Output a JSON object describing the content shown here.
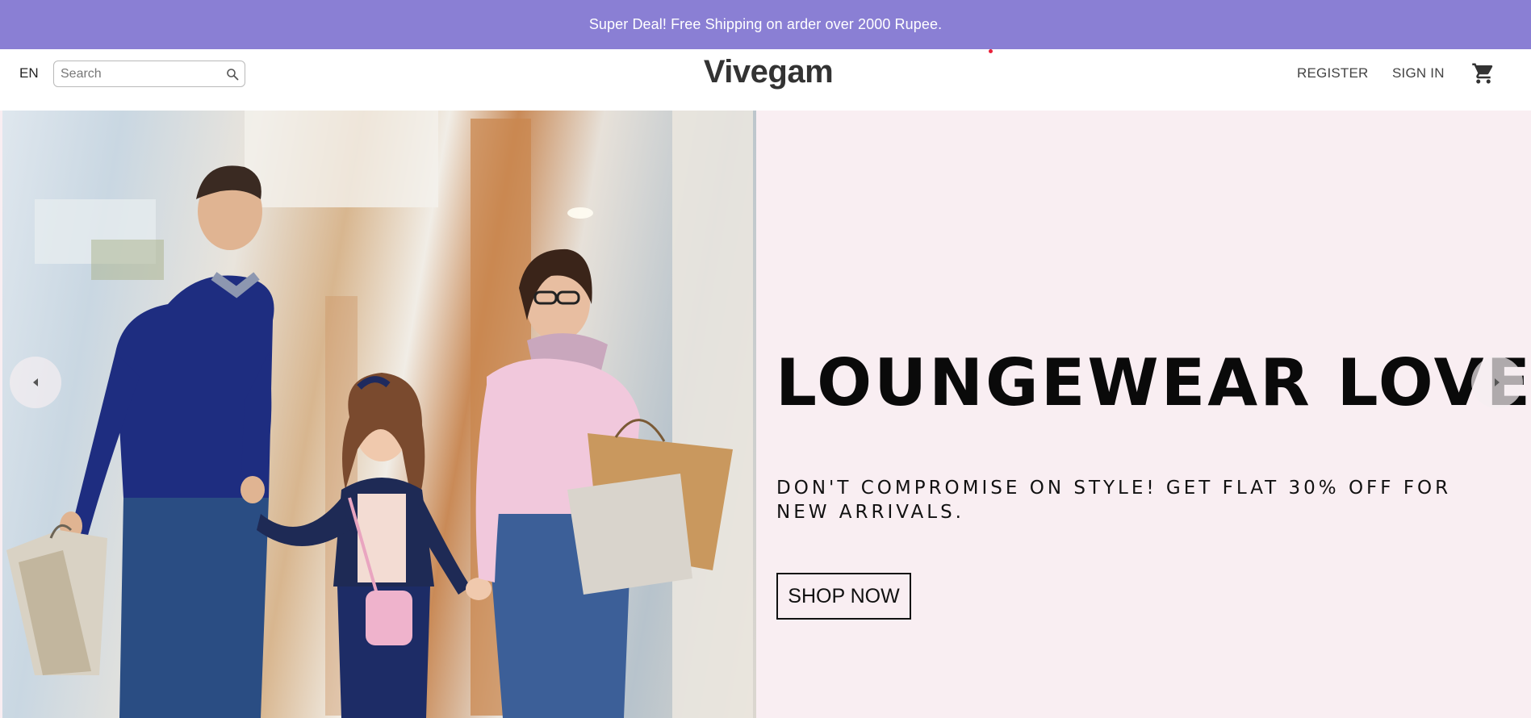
{
  "announcement": {
    "text": "Super Deal! Free Shipping on arder over 2000 Rupee."
  },
  "header": {
    "language": "EN",
    "search_placeholder": "Search",
    "logo": "Vivegam",
    "register_label": "REGISTER",
    "signin_label": "SIGN IN",
    "icons": {
      "search": "search-icon",
      "cart": "cart-icon"
    }
  },
  "hero": {
    "title": "LOUNGEWEAR LOVE",
    "subtitle": "DON'T COMPROMISE ON STYLE! GET FLAT 30% OFF FOR NEW ARRIVALS.",
    "cta_label": "SHOP NOW",
    "image_alt": "family-shopping-photo",
    "icons": {
      "prev": "chevron-left-icon",
      "next": "chevron-right-icon"
    }
  },
  "colors": {
    "announcement_bg": "#8a7fd4",
    "hero_bg": "#f9eef2",
    "accent_dot": "#e8213a"
  }
}
